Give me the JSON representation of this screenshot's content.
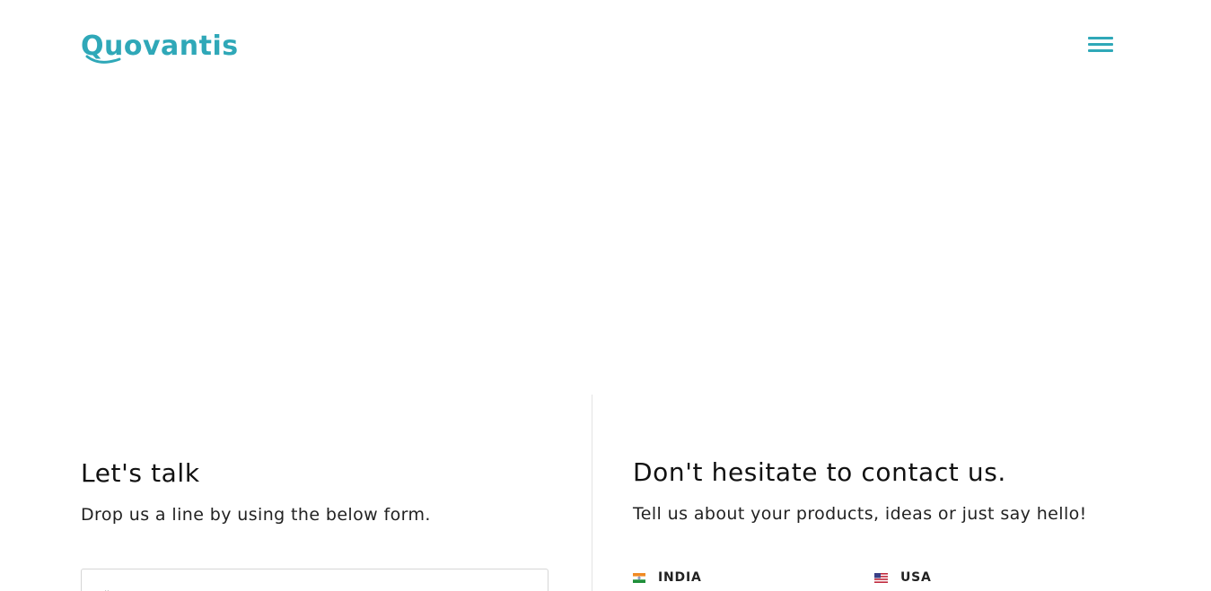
{
  "header": {
    "logo_text": "Quovantis",
    "menu_icon": "hamburger-menu-icon",
    "accent_color": "#2fa8b8"
  },
  "contact_form": {
    "title": "Let's talk",
    "subtitle": "Drop us a line by using the below form.",
    "full_name_placeholder": "Full Name*",
    "full_name_value": ""
  },
  "contact_info": {
    "title": "Don't hesitate to contact us.",
    "subtitle": "Tell us about your products, ideas or just say hello!",
    "locations": [
      {
        "label": "INDIA",
        "flag_icon": "india-flag-icon"
      },
      {
        "label": "USA",
        "flag_icon": "usa-flag-icon"
      }
    ]
  }
}
